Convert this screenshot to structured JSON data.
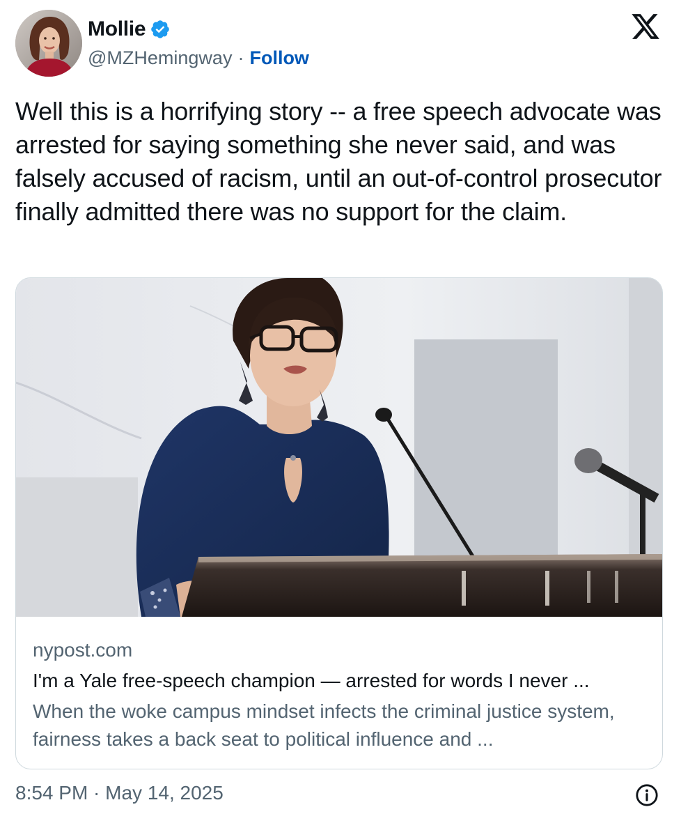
{
  "author": {
    "display_name": "Mollie",
    "handle": "@MZHemingway",
    "separator": "·",
    "follow_label": "Follow",
    "verified": true
  },
  "tweet": {
    "text": "Well this is a horrifying story -- a free speech advocate was arrested for saying something she never said, and was falsely accused of racism, until an out-of-control prosecutor finally admitted there was no support for the claim."
  },
  "card": {
    "domain": "nypost.com",
    "title": "I'm a Yale free-speech champion — arrested for words I never ...",
    "description": "When the woke campus mindset infects the criminal justice system, fairness takes a back seat to political influence and ..."
  },
  "footer": {
    "timestamp": "8:54 PM · May 14, 2025"
  },
  "icons": {
    "verified": "verified-badge-icon",
    "logo": "x-logo-icon",
    "info": "info-icon"
  },
  "colors": {
    "text_primary": "#0f1419",
    "text_secondary": "#536471",
    "link": "#0058b8",
    "verified_blue": "#1d9bf0",
    "card_border": "#cfd9de"
  }
}
